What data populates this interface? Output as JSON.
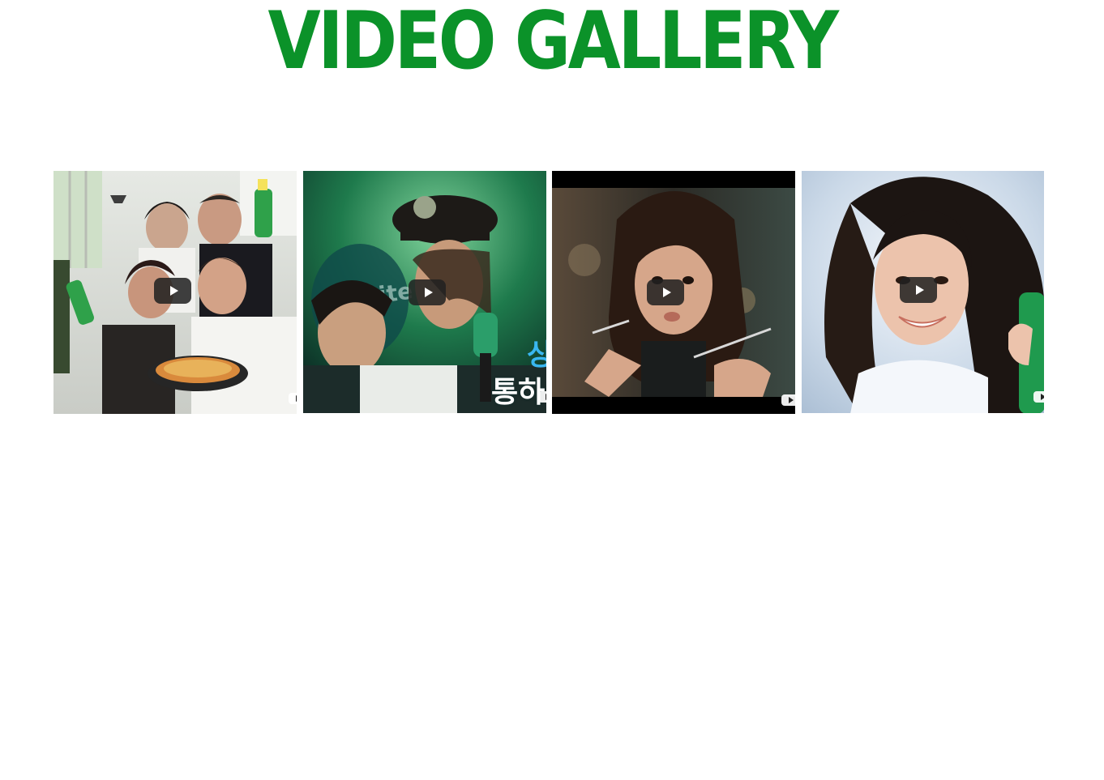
{
  "page": {
    "title": "VIDEO GALLERY"
  },
  "colors": {
    "title_green": "#0b9229",
    "play_button_bg": "#212121",
    "overlay_blue": "#39b6f0"
  },
  "videos": [
    {
      "description_icon": "play-icon",
      "overlay_line1": "",
      "overlay_line2": ""
    },
    {
      "description_icon": "play-icon",
      "overlay_line1": "상",
      "overlay_line2": "통하"
    },
    {
      "description_icon": "play-icon",
      "overlay_line1": "",
      "overlay_line2": ""
    },
    {
      "description_icon": "play-icon",
      "overlay_line1": "",
      "overlay_line2": ""
    }
  ]
}
